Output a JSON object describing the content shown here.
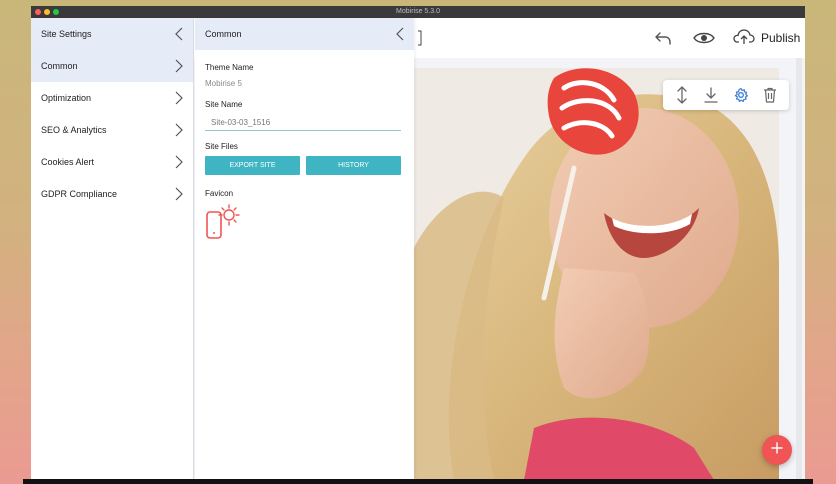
{
  "app": {
    "window_title": "Mobirise 5.3.0"
  },
  "toolbar": {
    "publish_label": "Publish",
    "undo_icon": "undo-icon",
    "preview_icon": "eye-icon",
    "publish_icon": "cloud-upload-icon"
  },
  "site_settings": {
    "title": "Site Settings",
    "items": [
      {
        "label": "Common",
        "active": true
      },
      {
        "label": "Optimization",
        "active": false
      },
      {
        "label": "SEO & Analytics",
        "active": false
      },
      {
        "label": "Cookies Alert",
        "active": false
      },
      {
        "label": "GDPR Compliance",
        "active": false
      }
    ]
  },
  "common_panel": {
    "title": "Common",
    "theme_name_label": "Theme Name",
    "theme_name_value": "Mobirise 5",
    "site_name_label": "Site Name",
    "site_name_value": "Site-03-03_1516",
    "site_files_label": "Site Files",
    "export_button": "EXPORT SITE",
    "history_button": "HISTORY",
    "favicon_label": "Favicon"
  },
  "block_tools": [
    "move-icon",
    "download-icon",
    "gear-icon",
    "trash-icon"
  ],
  "colors": {
    "accent": "#3fb4c2",
    "active_bg": "#e5ebf7",
    "fab": "#f05454",
    "gear": "#3a7bd5"
  }
}
